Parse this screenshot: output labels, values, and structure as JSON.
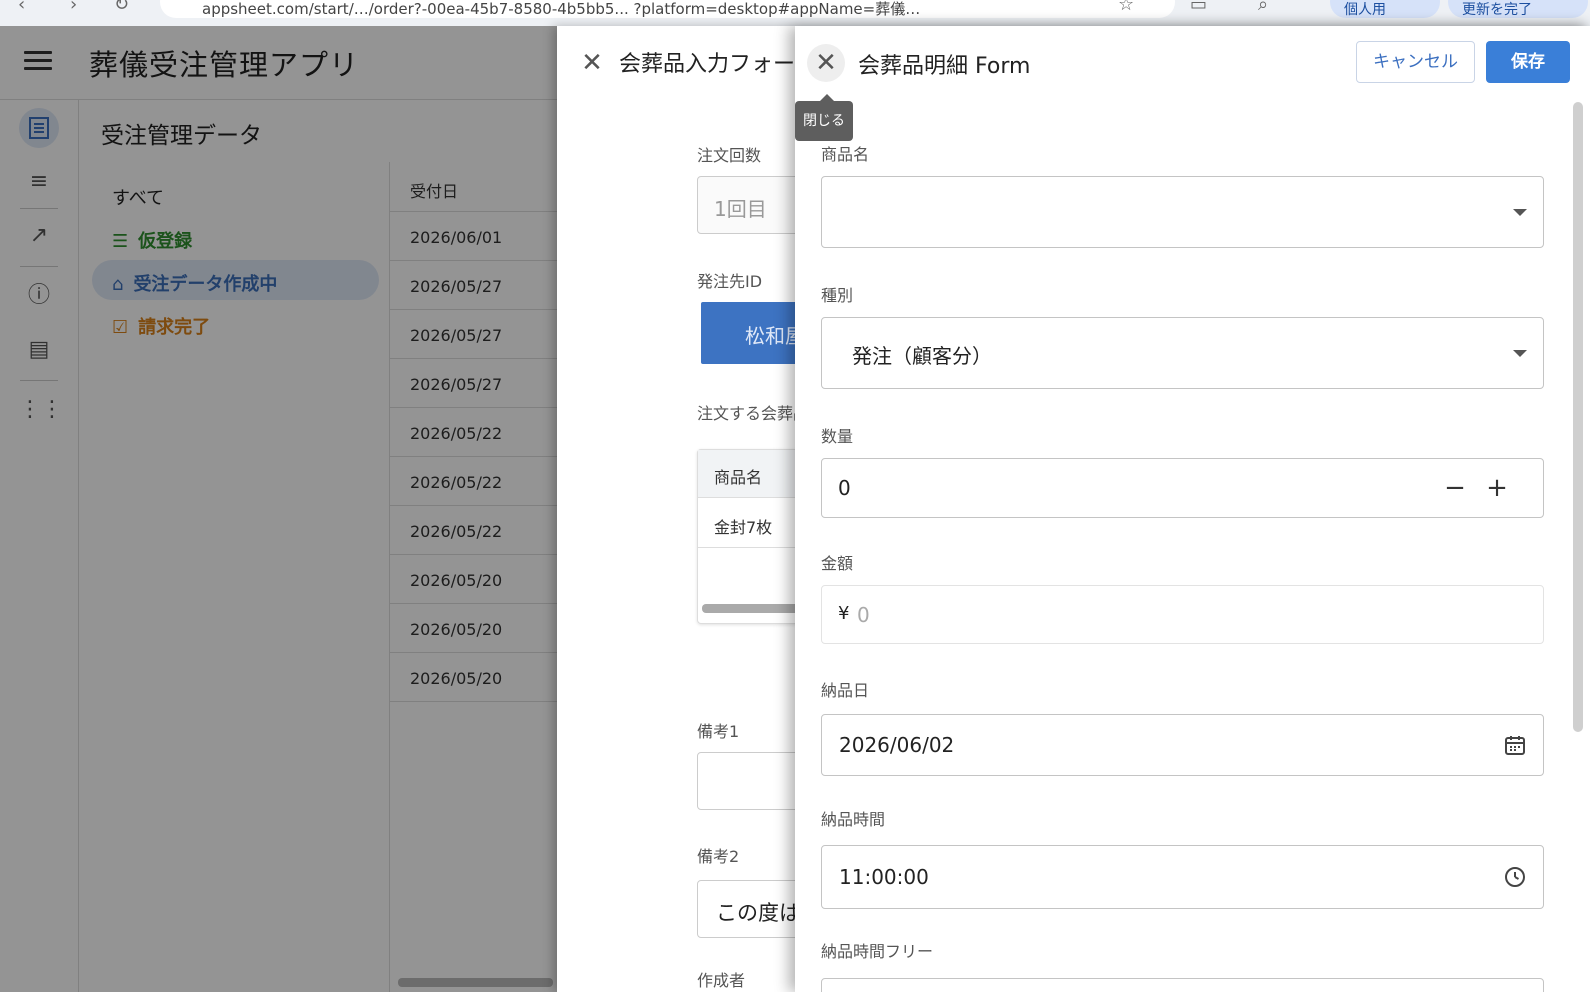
{
  "browser": {
    "url_text": "appsheet.com/start/…/order?-00ea-45b7-8580-4b5bb5... ?platform=desktop#appName=葬儀…",
    "profile_label": "個人用",
    "update_label": "更新を完了"
  },
  "app": {
    "title": "葬儀受注管理アプリ",
    "view_title": "受注管理データ",
    "filters": {
      "all": "すべて",
      "items": [
        {
          "label": "仮登録",
          "color": "#2f8f2f"
        },
        {
          "label": "受注データ作成中",
          "color": "#3c6fb8"
        },
        {
          "label": "請求完了",
          "color": "#d9821b"
        }
      ]
    },
    "table": {
      "header": "受付日",
      "rows": [
        "2026/06/01",
        "2026/05/27",
        "2026/05/27",
        "2026/05/27",
        "2026/05/22",
        "2026/05/22",
        "2026/05/22",
        "2026/05/20",
        "2026/05/20",
        "2026/05/20"
      ]
    },
    "rail_icons": [
      "list-view-icon",
      "menu-lines-icon",
      "external-link-icon",
      "info-icon",
      "feedback-icon",
      "apps-grid-icon"
    ]
  },
  "order_form": {
    "title": "会葬品入力フォーム",
    "count_label": "注文回数",
    "count_value": "1回目",
    "vendor_label": "発注先ID",
    "vendor_value": "松和屋",
    "items_label": "注文する会葬品",
    "items_header": "商品名",
    "items_rows": [
      "金封7枚"
    ],
    "note1_label": "備考1",
    "note2_label": "備考2",
    "note2_value": "この度は",
    "author_label": "作成者"
  },
  "detail_form": {
    "title": "会葬品明細 Form",
    "cancel_label": "キャンセル",
    "save_label": "保存",
    "tooltip": "閉じる",
    "product_label": "商品名",
    "product_value": "",
    "type_label": "種別",
    "type_value": "発注（顧客分）",
    "qty_label": "数量",
    "qty_value": "0",
    "amount_label": "金額",
    "currency_symbol": "¥",
    "amount_placeholder": "0",
    "date_label": "納品日",
    "date_value": "2026/06/02",
    "time_label": "納品時間",
    "time_value": "11:00:00",
    "free_time_label": "納品時間フリー"
  },
  "colors": {
    "accent": "#3a7fd8",
    "selected_bg": "#dfe8f7",
    "tooltip_bg": "#5e5e5e"
  }
}
